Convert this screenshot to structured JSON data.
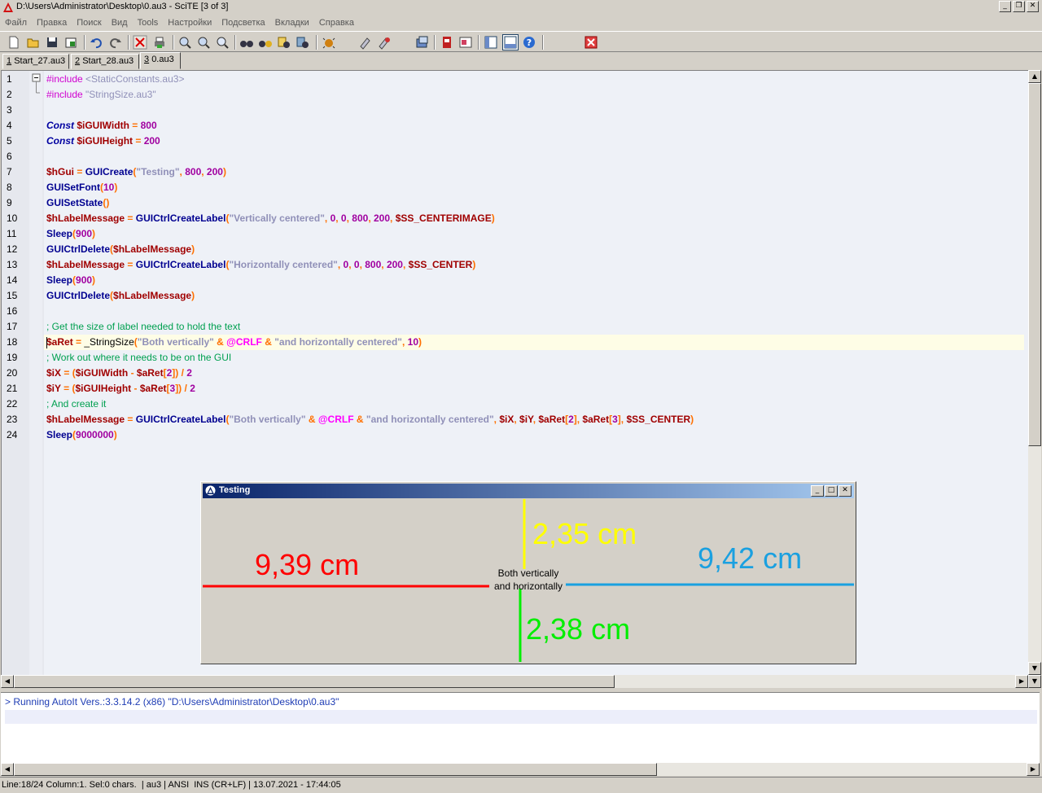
{
  "window": {
    "title": "D:\\Users\\Administrator\\Desktop\\0.au3 - SciTE [3 of 3]",
    "controls": [
      "_",
      "❐",
      "✕"
    ]
  },
  "menu": [
    "Файл",
    "Правка",
    "Поиск",
    "Вид",
    "Tools",
    "Настройки",
    "Подсветка",
    "Вкладки",
    "Справка"
  ],
  "tabs": [
    {
      "num": "1",
      "label": "Start_27.au3"
    },
    {
      "num": "2",
      "label": "Start_28.au3"
    },
    {
      "num": "3",
      "label": "0.au3"
    }
  ],
  "toolbar_icons": [
    "new-file-icon",
    "open-file-icon",
    "save-icon",
    "save-all-icon",
    "undo-icon",
    "redo-icon",
    "cut-icon",
    "print-icon",
    "find-icon",
    "find-next-icon",
    "zoom-icon",
    "binoculars-icon",
    "replace-icon",
    "find-in-files-icon",
    "bookmark-icon",
    "compile-icon",
    "run-icon",
    "build-icon",
    "stop-icon",
    "tidy-icon",
    "koda-icon",
    "window-icon",
    "split-icon",
    "help-icon",
    "close-red-icon"
  ],
  "editor": {
    "line_numbers": [
      "1",
      "2",
      "3",
      "4",
      "5",
      "6",
      "7",
      "8",
      "9",
      "10",
      "11",
      "12",
      "13",
      "14",
      "15",
      "16",
      "17",
      "18",
      "19",
      "20",
      "21",
      "22",
      "23",
      "24"
    ],
    "lines": [
      [
        {
          "t": "#include ",
          "c": "pp"
        },
        {
          "t": "<StaticConstants.au3>",
          "c": "ppv"
        }
      ],
      [
        {
          "t": "#include ",
          "c": "pp"
        },
        {
          "t": "\"StringSize.au3\"",
          "c": "ppv"
        }
      ],
      [],
      [
        {
          "t": "Const",
          "c": "k"
        },
        {
          "t": " ",
          "c": "pl"
        },
        {
          "t": "$iGUIWidth",
          "c": "v"
        },
        {
          "t": " = ",
          "c": "o"
        },
        {
          "t": "800",
          "c": "n"
        }
      ],
      [
        {
          "t": "Const",
          "c": "k"
        },
        {
          "t": " ",
          "c": "pl"
        },
        {
          "t": "$iGUIHeight",
          "c": "v"
        },
        {
          "t": " = ",
          "c": "o"
        },
        {
          "t": "200",
          "c": "n"
        }
      ],
      [],
      [
        {
          "t": "$hGui",
          "c": "v"
        },
        {
          "t": " = ",
          "c": "o"
        },
        {
          "t": "GUICreate",
          "c": "f"
        },
        {
          "t": "(",
          "c": "o"
        },
        {
          "t": "\"Testing\"",
          "c": "s"
        },
        {
          "t": ", ",
          "c": "o"
        },
        {
          "t": "800",
          "c": "n"
        },
        {
          "t": ", ",
          "c": "o"
        },
        {
          "t": "200",
          "c": "n"
        },
        {
          "t": ")",
          "c": "o"
        }
      ],
      [
        {
          "t": "GUISetFont",
          "c": "f"
        },
        {
          "t": "(",
          "c": "o"
        },
        {
          "t": "10",
          "c": "n"
        },
        {
          "t": ")",
          "c": "o"
        }
      ],
      [
        {
          "t": "GUISetState",
          "c": "f"
        },
        {
          "t": "()",
          "c": "o"
        }
      ],
      [
        {
          "t": "$hLabelMessage",
          "c": "v"
        },
        {
          "t": " = ",
          "c": "o"
        },
        {
          "t": "GUICtrlCreateLabel",
          "c": "f"
        },
        {
          "t": "(",
          "c": "o"
        },
        {
          "t": "\"Vertically centered\"",
          "c": "s"
        },
        {
          "t": ", ",
          "c": "o"
        },
        {
          "t": "0",
          "c": "n"
        },
        {
          "t": ", ",
          "c": "o"
        },
        {
          "t": "0",
          "c": "n"
        },
        {
          "t": ", ",
          "c": "o"
        },
        {
          "t": "800",
          "c": "n"
        },
        {
          "t": ", ",
          "c": "o"
        },
        {
          "t": "200",
          "c": "n"
        },
        {
          "t": ", ",
          "c": "o"
        },
        {
          "t": "$SS_CENTERIMAGE",
          "c": "v"
        },
        {
          "t": ")",
          "c": "o"
        }
      ],
      [
        {
          "t": "Sleep",
          "c": "f"
        },
        {
          "t": "(",
          "c": "o"
        },
        {
          "t": "900",
          "c": "n"
        },
        {
          "t": ")",
          "c": "o"
        }
      ],
      [
        {
          "t": "GUICtrlDelete",
          "c": "f"
        },
        {
          "t": "(",
          "c": "o"
        },
        {
          "t": "$hLabelMessage",
          "c": "v"
        },
        {
          "t": ")",
          "c": "o"
        }
      ],
      [
        {
          "t": "$hLabelMessage",
          "c": "v"
        },
        {
          "t": " = ",
          "c": "o"
        },
        {
          "t": "GUICtrlCreateLabel",
          "c": "f"
        },
        {
          "t": "(",
          "c": "o"
        },
        {
          "t": "\"Horizontally centered\"",
          "c": "s"
        },
        {
          "t": ", ",
          "c": "o"
        },
        {
          "t": "0",
          "c": "n"
        },
        {
          "t": ", ",
          "c": "o"
        },
        {
          "t": "0",
          "c": "n"
        },
        {
          "t": ", ",
          "c": "o"
        },
        {
          "t": "800",
          "c": "n"
        },
        {
          "t": ", ",
          "c": "o"
        },
        {
          "t": "200",
          "c": "n"
        },
        {
          "t": ", ",
          "c": "o"
        },
        {
          "t": "$SS_CENTER",
          "c": "v"
        },
        {
          "t": ")",
          "c": "o"
        }
      ],
      [
        {
          "t": "Sleep",
          "c": "f"
        },
        {
          "t": "(",
          "c": "o"
        },
        {
          "t": "900",
          "c": "n"
        },
        {
          "t": ")",
          "c": "o"
        }
      ],
      [
        {
          "t": "GUICtrlDelete",
          "c": "f"
        },
        {
          "t": "(",
          "c": "o"
        },
        {
          "t": "$hLabelMessage",
          "c": "v"
        },
        {
          "t": ")",
          "c": "o"
        }
      ],
      [],
      [
        {
          "t": "; Get the size of label needed to hold the text",
          "c": "c"
        }
      ],
      [
        {
          "t": "$aRet",
          "c": "v"
        },
        {
          "t": " = ",
          "c": "o"
        },
        {
          "t": "_StringSize",
          "c": "pl"
        },
        {
          "t": "(",
          "c": "o"
        },
        {
          "t": "\"Both vertically\"",
          "c": "s"
        },
        {
          "t": " & ",
          "c": "o"
        },
        {
          "t": "@CRLF",
          "c": "m"
        },
        {
          "t": " & ",
          "c": "o"
        },
        {
          "t": "\"and horizontally centered\"",
          "c": "s"
        },
        {
          "t": ", ",
          "c": "o"
        },
        {
          "t": "10",
          "c": "n"
        },
        {
          "t": ")",
          "c": "o"
        }
      ],
      [
        {
          "t": "; Work out where it needs to be on the GUI",
          "c": "c"
        }
      ],
      [
        {
          "t": "$iX",
          "c": "v"
        },
        {
          "t": " = (",
          "c": "o"
        },
        {
          "t": "$iGUIWidth",
          "c": "v"
        },
        {
          "t": " - ",
          "c": "o"
        },
        {
          "t": "$aRet",
          "c": "v"
        },
        {
          "t": "[",
          "c": "o"
        },
        {
          "t": "2",
          "c": "n"
        },
        {
          "t": "]) / ",
          "c": "o"
        },
        {
          "t": "2",
          "c": "n"
        }
      ],
      [
        {
          "t": "$iY",
          "c": "v"
        },
        {
          "t": " = (",
          "c": "o"
        },
        {
          "t": "$iGUIHeight",
          "c": "v"
        },
        {
          "t": " - ",
          "c": "o"
        },
        {
          "t": "$aRet",
          "c": "v"
        },
        {
          "t": "[",
          "c": "o"
        },
        {
          "t": "3",
          "c": "n"
        },
        {
          "t": "]) / ",
          "c": "o"
        },
        {
          "t": "2",
          "c": "n"
        }
      ],
      [
        {
          "t": "; And create it",
          "c": "c"
        }
      ],
      [
        {
          "t": "$hLabelMessage",
          "c": "v"
        },
        {
          "t": " = ",
          "c": "o"
        },
        {
          "t": "GUICtrlCreateLabel",
          "c": "f"
        },
        {
          "t": "(",
          "c": "o"
        },
        {
          "t": "\"Both vertically\"",
          "c": "s"
        },
        {
          "t": " & ",
          "c": "o"
        },
        {
          "t": "@CRLF",
          "c": "m"
        },
        {
          "t": " & ",
          "c": "o"
        },
        {
          "t": "\"and horizontally centered\"",
          "c": "s"
        },
        {
          "t": ", ",
          "c": "o"
        },
        {
          "t": "$iX",
          "c": "v"
        },
        {
          "t": ", ",
          "c": "o"
        },
        {
          "t": "$iY",
          "c": "v"
        },
        {
          "t": ", ",
          "c": "o"
        },
        {
          "t": "$aRet",
          "c": "v"
        },
        {
          "t": "[",
          "c": "o"
        },
        {
          "t": "2",
          "c": "n"
        },
        {
          "t": "], ",
          "c": "o"
        },
        {
          "t": "$aRet",
          "c": "v"
        },
        {
          "t": "[",
          "c": "o"
        },
        {
          "t": "3",
          "c": "n"
        },
        {
          "t": "], ",
          "c": "o"
        },
        {
          "t": "$SS_CENTER",
          "c": "v"
        },
        {
          "t": ")",
          "c": "o"
        }
      ],
      [
        {
          "t": "Sleep",
          "c": "f"
        },
        {
          "t": "(",
          "c": "o"
        },
        {
          "t": "9000000",
          "c": "n"
        },
        {
          "t": ")",
          "c": "o"
        }
      ]
    ],
    "current_line": 18
  },
  "gui_window": {
    "title": "Testing",
    "label_text": "Both vertically\nand horizontally\ncentered",
    "measurements": {
      "left": "9,39 cm",
      "right": "9,42 cm",
      "top": "2,35 cm",
      "bottom": "2,38 cm"
    }
  },
  "output": {
    "line": "> Running AutoIt Vers.:3.3.14.2 (x86) \"D:\\Users\\Administrator\\Desktop\\0.au3\""
  },
  "status": {
    "text": "Line:18/24 Column:1. Sel:0 chars.  | au3 | ANSI  INS (CR+LF) | 13.07.2021 - 17:44:05"
  },
  "colors": {
    "left_line": "#ff0000",
    "right_line": "#1aa0e0",
    "top_line": "#ffff00",
    "bottom_line": "#00ee00"
  }
}
